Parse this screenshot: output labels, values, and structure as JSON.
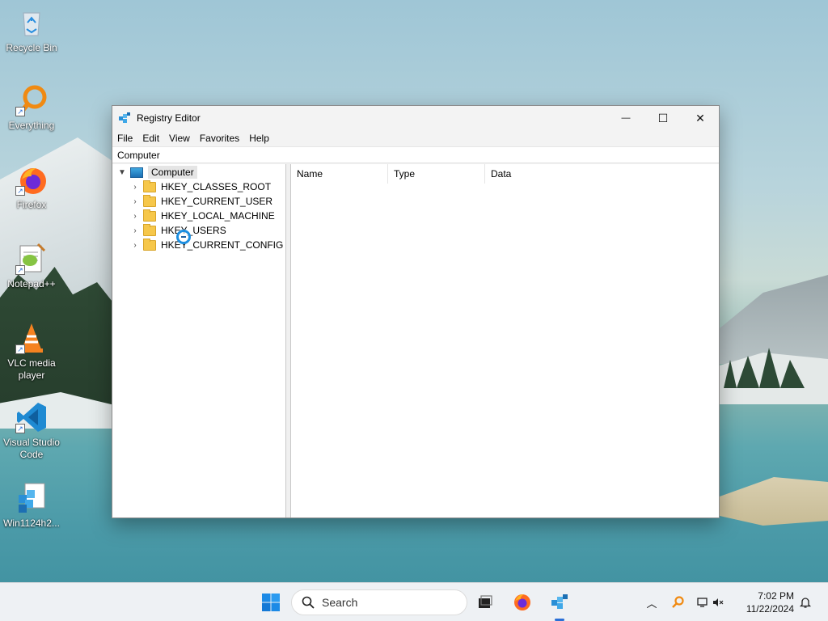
{
  "desktop": {
    "icons": [
      {
        "label": "Recycle Bin",
        "icon": "recycle-bin-icon"
      },
      {
        "label": "Everything",
        "icon": "everything-search-icon"
      },
      {
        "label": "Firefox",
        "icon": "firefox-icon"
      },
      {
        "label": "Notepad++",
        "icon": "notepadpp-icon"
      },
      {
        "label": "VLC media player",
        "icon": "vlc-icon"
      },
      {
        "label": "Visual Studio Code",
        "icon": "vscode-icon"
      },
      {
        "label": "Win1124h2...",
        "icon": "registry-file-icon"
      }
    ]
  },
  "window": {
    "title": "Registry Editor",
    "controls": {
      "minimize": "—",
      "maximize": "☐",
      "close": "✕"
    },
    "menu": [
      "File",
      "Edit",
      "View",
      "Favorites",
      "Help"
    ],
    "address": "Computer",
    "tree": {
      "root": "Computer",
      "hives": [
        "HKEY_CLASSES_ROOT",
        "HKEY_CURRENT_USER",
        "HKEY_LOCAL_MACHINE",
        "HKEY_USERS",
        "HKEY_CURRENT_CONFIG"
      ]
    },
    "columns": [
      "Name",
      "Type",
      "Data"
    ]
  },
  "taskbar": {
    "search_placeholder": "Search",
    "clock": {
      "time": "7:02 PM",
      "date": "11/22/2024"
    },
    "accent": "#2a6fd6"
  }
}
